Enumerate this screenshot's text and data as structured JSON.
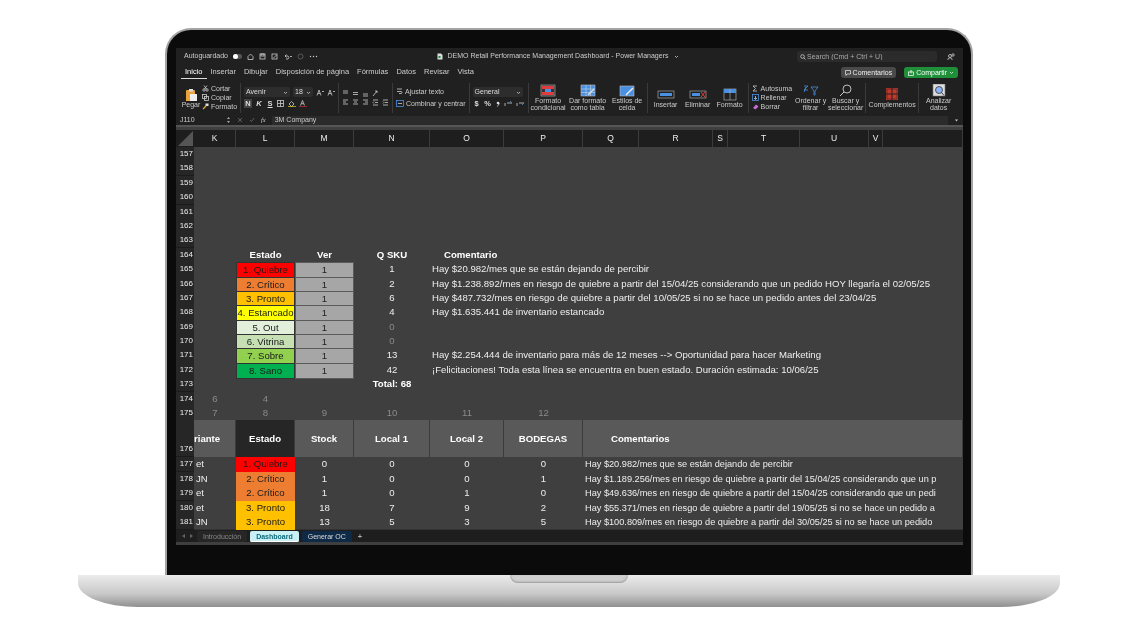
{
  "title_bar": {
    "autosave_label": "Autoguardado",
    "autosave_on": false,
    "title": "DEMO Retail Performance Management Dashboard - Power Managers",
    "search_placeholder": "Search (Cmd + Ctrl + U)"
  },
  "ribbon_tabs": [
    {
      "label": "Inicio",
      "selected": true
    },
    {
      "label": "Insertar",
      "selected": false
    },
    {
      "label": "Dibujar",
      "selected": false
    },
    {
      "label": "Disposición de página",
      "selected": false
    },
    {
      "label": "Fórmulas",
      "selected": false
    },
    {
      "label": "Datos",
      "selected": false
    },
    {
      "label": "Revisar",
      "selected": false
    },
    {
      "label": "Vista",
      "selected": false
    }
  ],
  "comments_button": "Comentarios",
  "share_button": "Compartir",
  "ribbon": {
    "paste": "Pegar",
    "clipboard_items": [
      {
        "kind": "cut",
        "label": "Cortar"
      },
      {
        "kind": "copy",
        "label": "Copiar"
      },
      {
        "kind": "brush",
        "label": "Formato"
      }
    ],
    "font_name": "Avenir",
    "font_size": "18",
    "font_styles": [
      "N",
      "K",
      "S"
    ],
    "wrap_text": "Ajustar texto",
    "merge": "Combinar y centrar",
    "number_format": "General",
    "number_symbols": [
      "$",
      "%"
    ],
    "big_buttons": [
      {
        "kind": "conditional",
        "label": "Formato condicional"
      },
      {
        "kind": "table",
        "label": "Dar formato como tabla"
      },
      {
        "kind": "styles",
        "label": "Estilos de celda"
      },
      {
        "kind": "insert",
        "label": "Insertar"
      },
      {
        "kind": "delete",
        "label": "Eliminar"
      },
      {
        "kind": "format",
        "label": "Formato"
      }
    ],
    "editing_items": [
      {
        "kind": "sum",
        "label": "Autosuma"
      },
      {
        "kind": "fill",
        "label": "Rellenar"
      },
      {
        "kind": "clear",
        "label": "Borrar"
      }
    ],
    "tools": [
      {
        "kind": "sort",
        "label": "Ordenar y filtrar"
      },
      {
        "kind": "find",
        "label": "Buscar y seleccionar"
      },
      {
        "kind": "addins",
        "label": "Complementos"
      },
      {
        "kind": "analyze",
        "label": "Analizar datos"
      }
    ]
  },
  "formula_bar": {
    "cell": "J110",
    "fx": "fx",
    "value": "3M Company"
  },
  "sheet": {
    "columns": [
      "K",
      "L",
      "M",
      "N",
      "O",
      "P",
      "Q",
      "R",
      "S",
      "T",
      "U",
      "V"
    ],
    "empty_rows": [
      "157",
      "158",
      "159",
      "160",
      "161",
      "162",
      "163"
    ],
    "summary": {
      "row": "164",
      "headers": [
        "Estado",
        "Ver",
        "Q SKU",
        "Comentario"
      ],
      "rows": [
        {
          "row": "165",
          "estado": "1. Quiebre",
          "color": "#ff0000",
          "ver": "1",
          "q_sku": "1",
          "dimmed": false,
          "comentario": "Hay $20.982/mes que se están dejando de percibir"
        },
        {
          "row": "166",
          "estado": "2. Crítico",
          "color": "#ed7d31",
          "ver": "1",
          "q_sku": "2",
          "dimmed": false,
          "comentario": "Hay $1.238.892/mes en riesgo de quiebre a partir del 15/04/25 considerando que un pedido HOY llegaría el 02/05/25"
        },
        {
          "row": "167",
          "estado": "3. Pronto",
          "color": "#ffc000",
          "ver": "1",
          "q_sku": "6",
          "dimmed": false,
          "comentario": "Hay $487.732/mes en riesgo de quiebre a partir del 10/05/25 si no se hace un pedido antes del 23/04/25"
        },
        {
          "row": "168",
          "estado": "4. Estancado",
          "color": "#ffff00",
          "ver": "1",
          "q_sku": "4",
          "dimmed": false,
          "comentario": "Hay $1.635.441 de inventario estancado"
        },
        {
          "row": "169",
          "estado": "5. Out",
          "color": "#e2efda",
          "ver": "1",
          "q_sku": "0",
          "dimmed": true
        },
        {
          "row": "170",
          "estado": "6. Vitrina",
          "color": "#c6e0b4",
          "ver": "1",
          "q_sku": "0",
          "dimmed": true
        },
        {
          "row": "171",
          "estado": "7. Sobre",
          "color": "#92d050",
          "ver": "1",
          "q_sku": "13",
          "dimmed": false,
          "comentario": "Hay $2.254.444 de inventario para más de 12 meses --> Oportunidad para hacer Marketing"
        },
        {
          "row": "172",
          "estado": "8. Sano",
          "color": "#00b050",
          "ver": "1",
          "q_sku": "42",
          "dimmed": false,
          "comentario": "¡Felicitaciones! Toda esta línea se encuentra en buen estado. Duración estimada: 10/06/25"
        }
      ],
      "total_row": "173",
      "total": "Total: 68"
    },
    "faint_rows": [
      {
        "row": "174",
        "cells": [
          "6",
          "4"
        ]
      },
      {
        "row": "175",
        "cells": [
          "7",
          "8",
          "9",
          "10",
          "11",
          "12"
        ]
      }
    ],
    "detail": {
      "row": "176",
      "headers": [
        "riante",
        "Estado",
        "Stock",
        "Local 1",
        "Local 2",
        "BODEGAS",
        "Comentarios"
      ],
      "rows": [
        {
          "row": "177",
          "variante": "et",
          "estado": "1. Quiebre",
          "color": "#ff0000",
          "stock": "0",
          "local_1": "0",
          "local_2": "0",
          "bodegas": "0",
          "comentario": "Hay $20.982/mes que se están dejando de percibir"
        },
        {
          "row": "178",
          "variante": "JN",
          "estado": "2. Crítico",
          "color": "#ed7d31",
          "stock": "1",
          "local_1": "0",
          "local_2": "0",
          "bodegas": "1",
          "comentario": "Hay $1.189.256/mes en riesgo de quiebre a partir del 15/04/25 considerando que un p"
        },
        {
          "row": "179",
          "variante": "et",
          "estado": "2. Crítico",
          "color": "#ed7d31",
          "stock": "1",
          "local_1": "0",
          "local_2": "1",
          "bodegas": "0",
          "comentario": "Hay $49.636/mes en riesgo de quiebre a partir del 15/04/25 considerando que un pedi"
        },
        {
          "row": "180",
          "variante": "et",
          "estado": "3. Pronto",
          "color": "#ffc000",
          "stock": "18",
          "local_1": "7",
          "local_2": "9",
          "bodegas": "2",
          "comentario": "Hay $55.371/mes en riesgo de quiebre a partir del 19/05/25 si no se hace un pedido a"
        },
        {
          "row": "181",
          "variante": "JN",
          "estado": "3. Pronto",
          "color": "#ffc000",
          "stock": "13",
          "local_1": "5",
          "local_2": "3",
          "bodegas": "5",
          "comentario": "Hay $100.809/mes en riesgo de quiebre a partir del 30/05/25 si no se hace un pedido"
        }
      ]
    }
  },
  "sheet_tabs": [
    {
      "label": "Introducción",
      "selected": false
    },
    {
      "label": "Dashboard",
      "selected": true,
      "color": "#c9f1f5"
    },
    {
      "label": "Generar OC",
      "selected": false,
      "color": "#0e2a47"
    }
  ],
  "add_sheet": "+"
}
